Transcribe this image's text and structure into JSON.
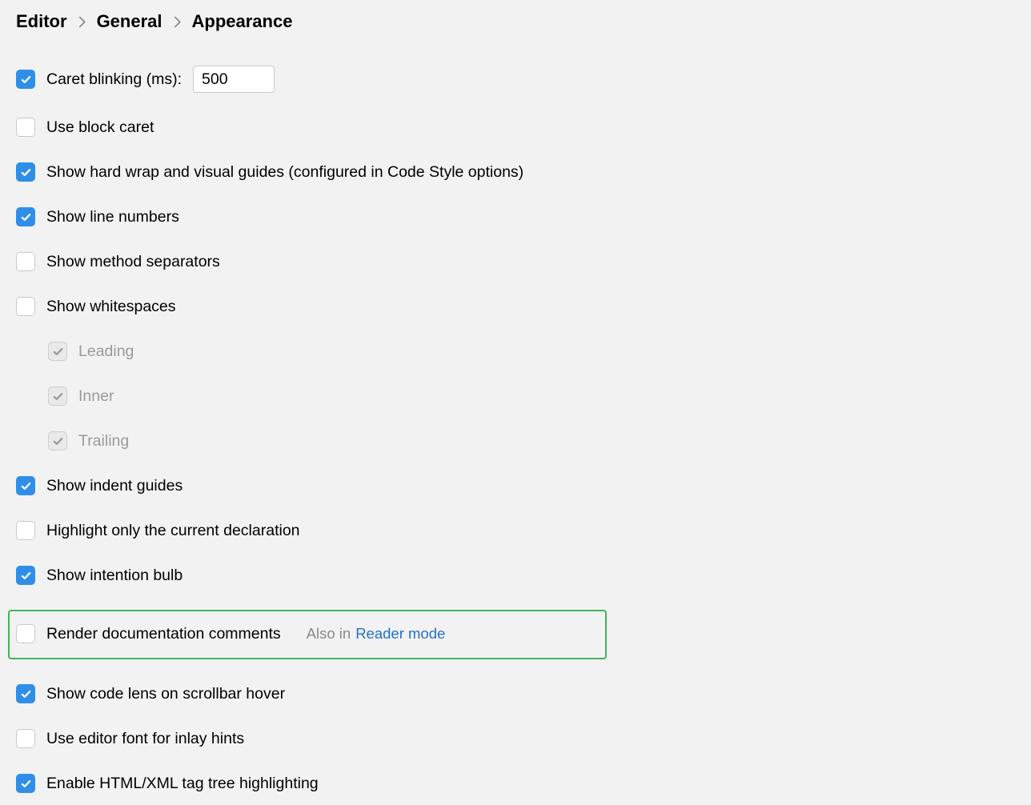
{
  "breadcrumb": {
    "part1": "Editor",
    "part2": "General",
    "part3": "Appearance"
  },
  "options": {
    "caret_blinking": {
      "label": "Caret blinking (ms):",
      "value": "500"
    },
    "use_block_caret": {
      "label": "Use block caret"
    },
    "show_hard_wrap": {
      "label": "Show hard wrap and visual guides (configured in Code Style options)"
    },
    "show_line_numbers": {
      "label": "Show line numbers"
    },
    "show_method_separators": {
      "label": "Show method separators"
    },
    "show_whitespaces": {
      "label": "Show whitespaces"
    },
    "ws_leading": {
      "label": "Leading"
    },
    "ws_inner": {
      "label": "Inner"
    },
    "ws_trailing": {
      "label": "Trailing"
    },
    "show_indent_guides": {
      "label": "Show indent guides"
    },
    "highlight_current_decl": {
      "label": "Highlight only the current declaration"
    },
    "show_intention_bulb": {
      "label": "Show intention bulb"
    },
    "render_doc_comments": {
      "label": "Render documentation comments",
      "also_in": "Also in",
      "link": "Reader mode"
    },
    "show_code_lens": {
      "label": "Show code lens on scrollbar hover"
    },
    "use_editor_font_inlay": {
      "label": "Use editor font for inlay hints"
    },
    "enable_html_xml_tree": {
      "label": "Enable HTML/XML tag tree highlighting"
    }
  }
}
